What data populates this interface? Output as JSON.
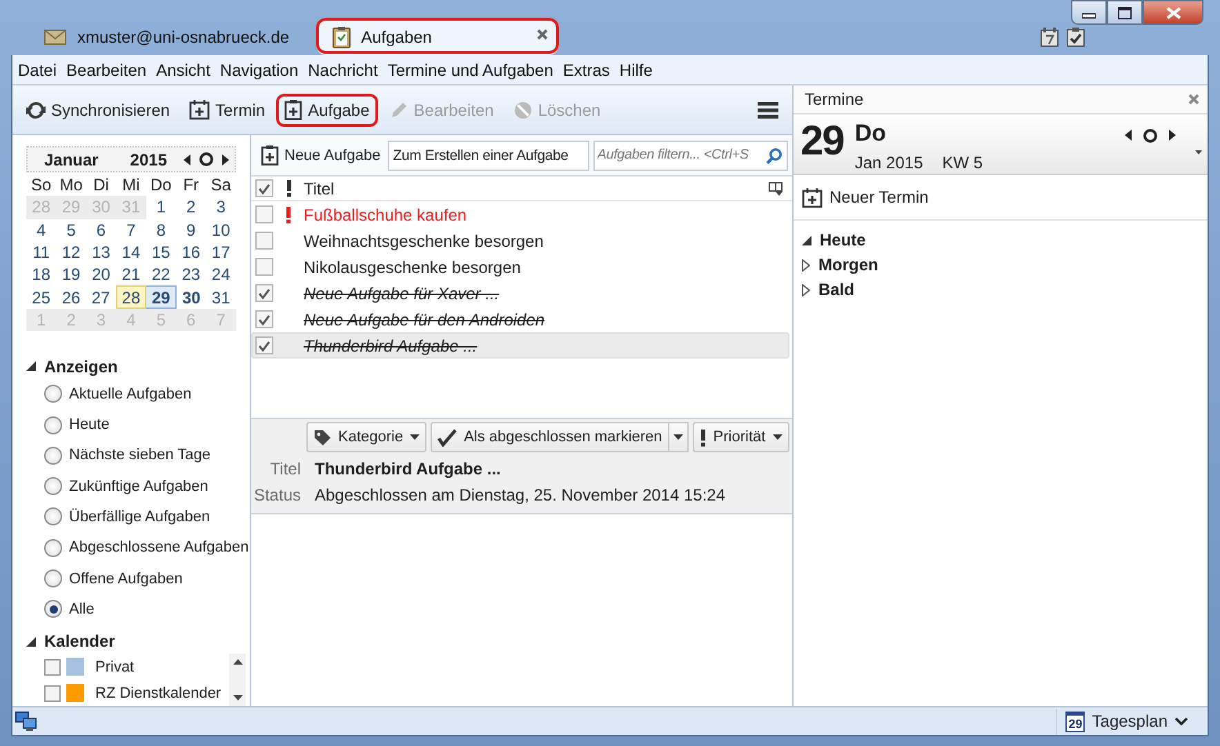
{
  "tabs": [
    {
      "label": "xmuster@uni-osnabrueck.de",
      "kind": "mail",
      "selected": false,
      "highlighted": false
    },
    {
      "label": "Aufgaben",
      "kind": "tasks",
      "selected": true,
      "highlighted": true
    }
  ],
  "menu": [
    "Datei",
    "Bearbeiten",
    "Ansicht",
    "Navigation",
    "Nachricht",
    "Termine und Aufgaben",
    "Extras",
    "Hilfe"
  ],
  "toolbar": [
    {
      "label": "Synchronisieren",
      "disabled": false,
      "highlighted": false
    },
    {
      "label": "Termin",
      "disabled": false,
      "highlighted": false
    },
    {
      "label": "Aufgabe",
      "disabled": false,
      "highlighted": true
    },
    {
      "label": "Bearbeiten",
      "disabled": true,
      "highlighted": false
    },
    {
      "label": "Löschen",
      "disabled": true,
      "highlighted": false
    }
  ],
  "minical": {
    "month": "Januar",
    "year": "2015",
    "weekdays": [
      "So",
      "Mo",
      "Di",
      "Mi",
      "Do",
      "Fr",
      "Sa"
    ],
    "weeks": [
      [
        {
          "day": "28",
          "outside": true,
          "today": false,
          "selected": false,
          "bold": false
        },
        {
          "day": "29",
          "outside": true,
          "today": false,
          "selected": false,
          "bold": false
        },
        {
          "day": "30",
          "outside": true,
          "today": false,
          "selected": false,
          "bold": false
        },
        {
          "day": "31",
          "outside": true,
          "today": false,
          "selected": false,
          "bold": false
        },
        {
          "day": "1",
          "outside": false,
          "today": false,
          "selected": false,
          "bold": false
        },
        {
          "day": "2",
          "outside": false,
          "today": false,
          "selected": false,
          "bold": false
        },
        {
          "day": "3",
          "outside": false,
          "today": false,
          "selected": false,
          "bold": false
        }
      ],
      [
        {
          "day": "4",
          "outside": false,
          "today": false,
          "selected": false,
          "bold": false
        },
        {
          "day": "5",
          "outside": false,
          "today": false,
          "selected": false,
          "bold": false
        },
        {
          "day": "6",
          "outside": false,
          "today": false,
          "selected": false,
          "bold": false
        },
        {
          "day": "7",
          "outside": false,
          "today": false,
          "selected": false,
          "bold": false
        },
        {
          "day": "8",
          "outside": false,
          "today": false,
          "selected": false,
          "bold": false
        },
        {
          "day": "9",
          "outside": false,
          "today": false,
          "selected": false,
          "bold": false
        },
        {
          "day": "10",
          "outside": false,
          "today": false,
          "selected": false,
          "bold": false
        }
      ],
      [
        {
          "day": "11",
          "outside": false,
          "today": false,
          "selected": false,
          "bold": false
        },
        {
          "day": "12",
          "outside": false,
          "today": false,
          "selected": false,
          "bold": false
        },
        {
          "day": "13",
          "outside": false,
          "today": false,
          "selected": false,
          "bold": false
        },
        {
          "day": "14",
          "outside": false,
          "today": false,
          "selected": false,
          "bold": false
        },
        {
          "day": "15",
          "outside": false,
          "today": false,
          "selected": false,
          "bold": false
        },
        {
          "day": "16",
          "outside": false,
          "today": false,
          "selected": false,
          "bold": false
        },
        {
          "day": "17",
          "outside": false,
          "today": false,
          "selected": false,
          "bold": false
        }
      ],
      [
        {
          "day": "18",
          "outside": false,
          "today": false,
          "selected": false,
          "bold": false
        },
        {
          "day": "19",
          "outside": false,
          "today": false,
          "selected": false,
          "bold": false
        },
        {
          "day": "20",
          "outside": false,
          "today": false,
          "selected": false,
          "bold": false
        },
        {
          "day": "21",
          "outside": false,
          "today": false,
          "selected": false,
          "bold": false
        },
        {
          "day": "22",
          "outside": false,
          "today": false,
          "selected": false,
          "bold": false
        },
        {
          "day": "23",
          "outside": false,
          "today": false,
          "selected": false,
          "bold": false
        },
        {
          "day": "24",
          "outside": false,
          "today": false,
          "selected": false,
          "bold": false
        }
      ],
      [
        {
          "day": "25",
          "outside": false,
          "today": false,
          "selected": false,
          "bold": false
        },
        {
          "day": "26",
          "outside": false,
          "today": false,
          "selected": false,
          "bold": false
        },
        {
          "day": "27",
          "outside": false,
          "today": false,
          "selected": false,
          "bold": false
        },
        {
          "day": "28",
          "outside": false,
          "today": true,
          "selected": false,
          "bold": false
        },
        {
          "day": "29",
          "outside": false,
          "today": false,
          "selected": true,
          "bold": true
        },
        {
          "day": "30",
          "outside": false,
          "today": false,
          "selected": false,
          "bold": true
        },
        {
          "day": "31",
          "outside": false,
          "today": false,
          "selected": false,
          "bold": false
        }
      ],
      [
        {
          "day": "1",
          "outside": true,
          "today": false,
          "selected": false,
          "bold": false
        },
        {
          "day": "2",
          "outside": true,
          "today": false,
          "selected": false,
          "bold": false
        },
        {
          "day": "3",
          "outside": true,
          "today": false,
          "selected": false,
          "bold": false
        },
        {
          "day": "4",
          "outside": true,
          "today": false,
          "selected": false,
          "bold": false
        },
        {
          "day": "5",
          "outside": true,
          "today": false,
          "selected": false,
          "bold": false
        },
        {
          "day": "6",
          "outside": true,
          "today": false,
          "selected": false,
          "bold": false
        },
        {
          "day": "7",
          "outside": true,
          "today": false,
          "selected": false,
          "bold": false
        }
      ]
    ]
  },
  "filters": {
    "title": "Anzeigen",
    "expanded": true,
    "options": [
      {
        "label": "Aktuelle Aufgaben",
        "selected": false
      },
      {
        "label": "Heute",
        "selected": false
      },
      {
        "label": "Nächste sieben Tage",
        "selected": false
      },
      {
        "label": "Zukünftige Aufgaben",
        "selected": false
      },
      {
        "label": "Überfällige Aufgaben",
        "selected": false
      },
      {
        "label": "Abgeschlossene Aufgaben",
        "selected": false
      },
      {
        "label": "Offene Aufgaben",
        "selected": false
      },
      {
        "label": "Alle",
        "selected": true
      }
    ]
  },
  "calendars": {
    "title": "Kalender",
    "expanded": true,
    "items": [
      {
        "name": "Privat",
        "checked": false,
        "color": "#a6c1e0"
      },
      {
        "name": "RZ Dienstkalender",
        "checked": false,
        "color": "#ff9900"
      }
    ]
  },
  "tasks": {
    "new_button": "Neue Aufgabe",
    "quick_add": {
      "placeholder": "Zum Erstellen einer Aufgabe"
    },
    "filter": {
      "placeholder": "Aufgaben filtern... <Ctrl+S"
    },
    "column_title": "Titel",
    "rows": [
      {
        "title": "Fußballschuhe kaufen",
        "completed": false,
        "high_priority": true,
        "selected": false
      },
      {
        "title": "Weihnachtsgeschenke besorgen",
        "completed": false,
        "high_priority": false,
        "selected": false
      },
      {
        "title": "Nikolausgeschenke besorgen",
        "completed": false,
        "high_priority": false,
        "selected": false
      },
      {
        "title": "Neue Aufgabe für Xaver ...",
        "completed": true,
        "high_priority": false,
        "selected": false
      },
      {
        "title": "Neue Aufgabe für den Androiden",
        "completed": true,
        "high_priority": false,
        "selected": false
      },
      {
        "title": "Thunderbird Aufgabe ...",
        "completed": true,
        "high_priority": false,
        "selected": true
      }
    ]
  },
  "details": {
    "actions": [
      {
        "label": "Kategorie",
        "kind": "menu"
      },
      {
        "label": "Als abgeschlossen markieren",
        "kind": "split"
      },
      {
        "label": "Priorität",
        "kind": "menu"
      }
    ],
    "fields": [
      {
        "label": "Titel",
        "value": "Thunderbird Aufgabe ..."
      },
      {
        "label": "Status",
        "value": "Abgeschlossen am Dienstag, 25. November 2014 15:24"
      }
    ]
  },
  "agenda": {
    "title": "Termine",
    "day": "29",
    "weekday": "Do",
    "month_year": "Jan 2015",
    "week": "KW 5",
    "new_button": "Neuer Termin",
    "sections": [
      {
        "label": "Heute",
        "expanded": true
      },
      {
        "label": "Morgen",
        "expanded": false
      },
      {
        "label": "Bald",
        "expanded": false
      }
    ]
  },
  "status_bar": {
    "view": "Tagesplan",
    "icon_day": "29"
  }
}
